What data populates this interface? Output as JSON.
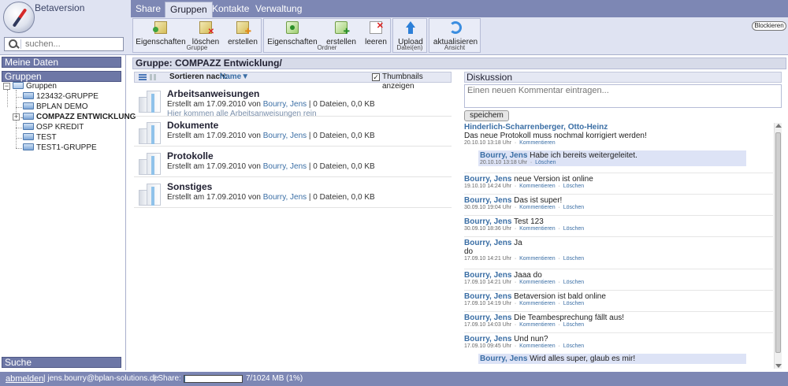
{
  "app": {
    "title": "Betaversion"
  },
  "search": {
    "placeholder": "suchen..."
  },
  "tabs": [
    {
      "label": "Share",
      "active": false
    },
    {
      "label": "Gruppen",
      "active": true
    },
    {
      "label": "Kontakte",
      "active": false
    },
    {
      "label": "Verwaltung",
      "active": false
    }
  ],
  "toolbar": {
    "block_label": "Blockieren",
    "groups": [
      {
        "label": "Gruppe",
        "buttons": [
          {
            "label": "Eigenschaften",
            "icon": "group-properties-icon"
          },
          {
            "label": "löschen",
            "icon": "group-delete-icon"
          },
          {
            "label": "erstellen",
            "icon": "group-create-icon"
          }
        ]
      },
      {
        "label": "Ordner",
        "buttons": [
          {
            "label": "Eigenschaften",
            "icon": "folder-properties-icon"
          },
          {
            "label": "erstellen",
            "icon": "folder-create-icon"
          },
          {
            "label": "leeren",
            "icon": "folder-clear-icon"
          }
        ]
      },
      {
        "label": "Datei(en)",
        "buttons": [
          {
            "label": "Upload",
            "icon": "upload-icon"
          }
        ]
      },
      {
        "label": "Ansicht",
        "buttons": [
          {
            "label": "aktualisieren",
            "icon": "refresh-icon"
          }
        ]
      }
    ]
  },
  "sidebar": {
    "my_data": "Meine Daten",
    "groups_header": "Gruppen",
    "search_header": "Suche",
    "tree": {
      "root": "Gruppen",
      "items": [
        {
          "label": "123432-GRUPPE"
        },
        {
          "label": "BPLAN DEMO"
        },
        {
          "label": "COMPAZZ ENTWICKLUNG"
        },
        {
          "label": "OSP KREDIT"
        },
        {
          "label": "TEST"
        },
        {
          "label": "TEST1-GRUPPE"
        }
      ]
    }
  },
  "main": {
    "title": "Gruppe: COMPAZZ Entwicklung/",
    "sort_label": "Sortieren nach:",
    "sort_value": "Name",
    "thumbnails_label": "Thumbnails anzeigen",
    "folders": [
      {
        "name": "Arbeitsanweisungen",
        "meta_prefix": "Erstellt am 17.09.2010 von",
        "author": "Bourry, Jens",
        "meta_suffix": "| 0 Dateien, 0,0 KB",
        "desc": "Hier kommen alle Arbeitsanweisungen rein"
      },
      {
        "name": "Dokumente",
        "meta_prefix": "Erstellt am 17.09.2010 von",
        "author": "Bourry, Jens",
        "meta_suffix": "| 0 Dateien, 0,0 KB"
      },
      {
        "name": "Protokolle",
        "meta_prefix": "Erstellt am 17.09.2010 von",
        "author": "Bourry, Jens",
        "meta_suffix": "| 0 Dateien, 0,0 KB"
      },
      {
        "name": "Sonstiges",
        "meta_prefix": "Erstellt am 17.09.2010 von",
        "author": "Bourry, Jens",
        "meta_suffix": "| 0 Dateien, 0,0 KB"
      }
    ]
  },
  "discussion": {
    "title": "Diskussion",
    "input_placeholder": "Einen neuen Kommentar eintragen...",
    "save_label": "speichem",
    "comment_label": "Kommentieren",
    "delete_label": "Löschen",
    "posts": [
      {
        "author": "Hinderlich-Scharrenberger, Otto-Heinz",
        "text": "Das neue Protokoll muss nochmal korrigiert werden!",
        "date": "20.10.10 13:18 Uhr",
        "reply": {
          "author": "Bourry, Jens",
          "text": "Habe ich bereits weitergeleitet.",
          "date": "20.10.10 13:18 Uhr",
          "delete": "Löschen"
        }
      },
      {
        "author": "Bourry, Jens",
        "text": "neue Version ist online",
        "date": "19.10.10 14:24 Uhr"
      },
      {
        "author": "Bourry, Jens",
        "text": "Das ist super!",
        "date": "30.09.10 19:04 Uhr"
      },
      {
        "author": "Bourry, Jens",
        "text": "Test 123",
        "date": "30.09.10 18:36 Uhr"
      },
      {
        "author": "Bourry, Jens",
        "text": "Ja",
        "text2": "do",
        "date": "17.09.10 14:21 Uhr"
      },
      {
        "author": "Bourry, Jens",
        "text": "Jaaa do",
        "date": "17.09.10 14:21 Uhr"
      },
      {
        "author": "Bourry, Jens",
        "text": "Betaversion ist bald online",
        "date": "17.09.10 14:19 Uhr"
      },
      {
        "author": "Bourry, Jens",
        "text": "Die Teambesprechung fällt aus!",
        "date": "17.09.10 14:03 Uhr"
      },
      {
        "author": "Bourry, Jens",
        "text": "Und nun?",
        "date": "17.09.10 09:45 Uhr",
        "reply": {
          "author": "Bourry, Jens",
          "text": "Wird alles super, glaub es mir!"
        }
      }
    ]
  },
  "footer": {
    "logout": "abmelden",
    "email": "| jens.bourry@bplan-solutions.de",
    "share_label": "| Share:",
    "share_used": "7/1024 MB (1%)",
    "share_percent": 1
  }
}
